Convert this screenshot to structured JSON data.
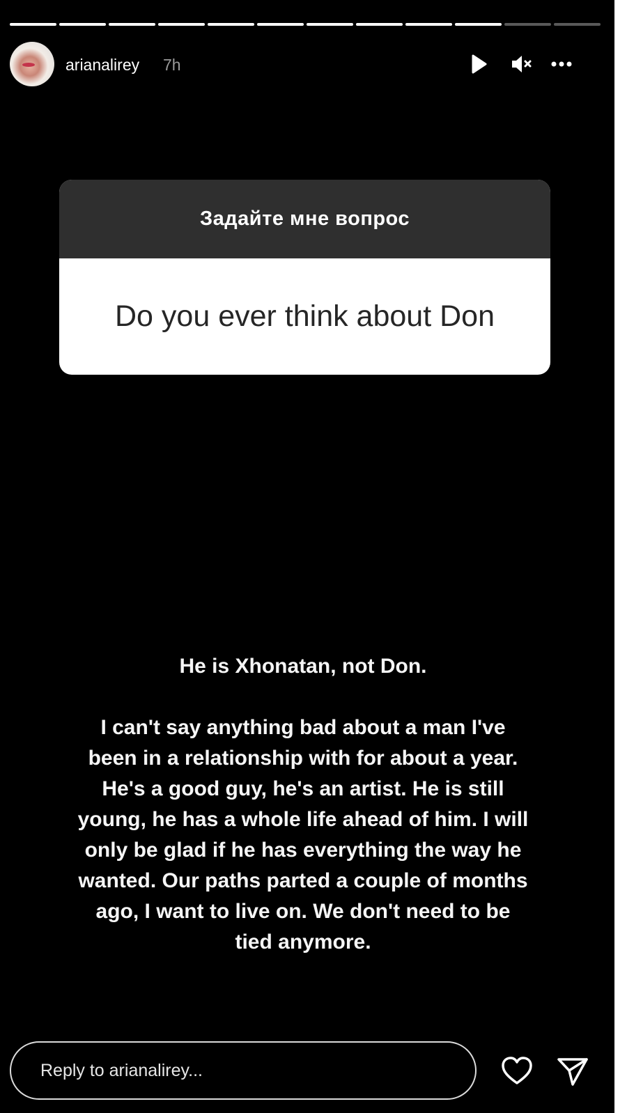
{
  "story": {
    "progress_segments": 12,
    "progress_completed": 10,
    "author": {
      "username": "arianalirey",
      "time_ago": "7h"
    },
    "controls": {
      "play_icon": "play-icon",
      "mute_icon": "muted-speaker-icon",
      "more_icon": "more-horizontal-icon"
    }
  },
  "question_sticker": {
    "prompt": "Задайте мне вопрос",
    "question": "Do you ever think about Don"
  },
  "answer": {
    "heading": "He is Xhonatan, not Don.",
    "body": "I can't say anything bad about a man I've been in a relationship with for about a year. He's a good guy, he's an artist. He is still young, he has a whole life ahead of him. I will only be glad if he has everything the way he wanted. Our paths parted a couple of months ago, I want to live on. We don't need to be tied anymore."
  },
  "reply": {
    "placeholder": "Reply to arianalirey...",
    "like_icon": "heart-icon",
    "share_icon": "send-icon"
  },
  "colors": {
    "background": "#000000",
    "sticker_header": "#2f2f2f",
    "sticker_body": "#ffffff"
  }
}
